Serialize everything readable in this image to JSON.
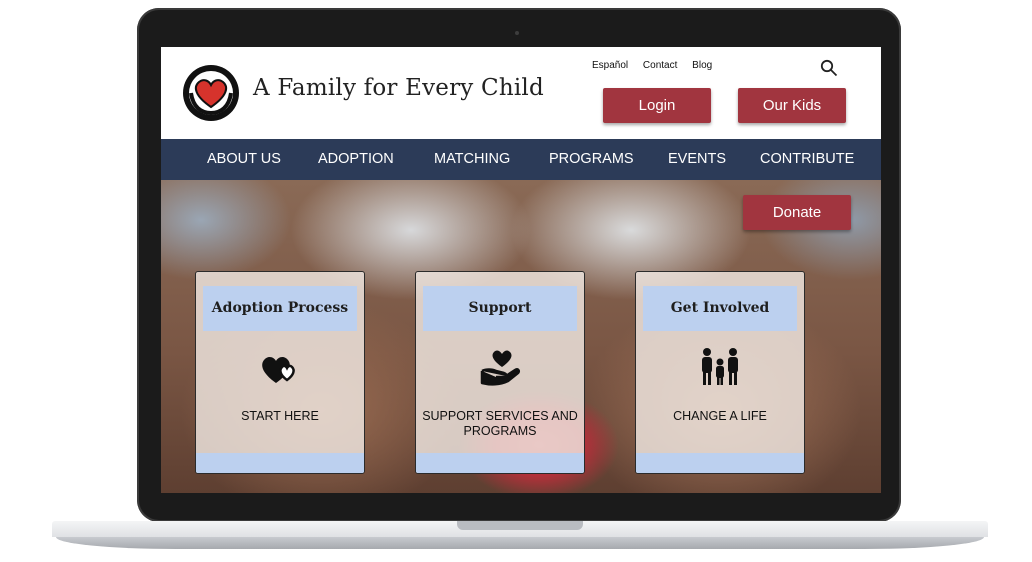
{
  "site": {
    "title": "A Family for Every Child"
  },
  "header": {
    "links": [
      "Español",
      "Contact",
      "Blog"
    ],
    "login_label": "Login",
    "our_kids_label": "Our Kids"
  },
  "nav": {
    "items": [
      "ABOUT US",
      "ADOPTION",
      "MATCHING",
      "PROGRAMS",
      "EVENTS",
      "CONTRIBUTE"
    ]
  },
  "hero": {
    "donate_label": "Donate",
    "cards": [
      {
        "title": "Adoption Process",
        "text": "START HERE",
        "icon": "hearts-icon"
      },
      {
        "title": "Support",
        "text": "SUPPORT SERVICES AND PROGRAMS",
        "icon": "hand-heart-icon"
      },
      {
        "title": "Get Involved",
        "text": "CHANGE A LIFE",
        "icon": "family-icon"
      }
    ]
  },
  "colors": {
    "brand_red": "#a1353f",
    "nav_navy": "#2c3b58",
    "card_blue": "#bcd0ef"
  }
}
